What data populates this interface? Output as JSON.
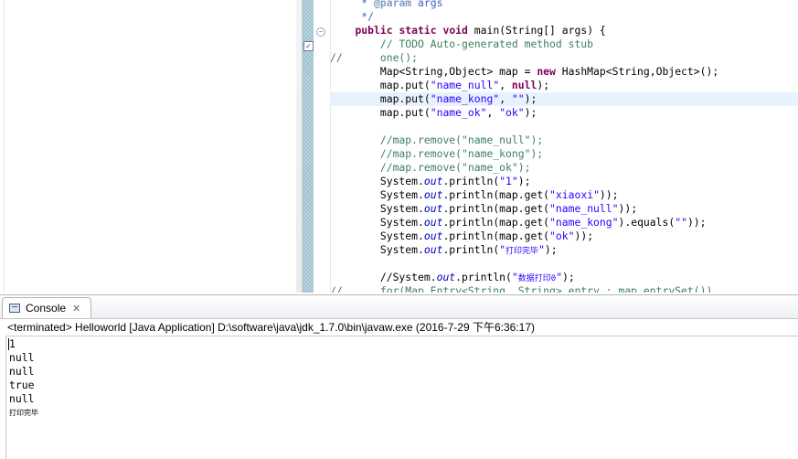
{
  "editor": {
    "lines": [
      "     * @param args",
      "     */",
      "    public static void main(String[] args) {",
      "        // TODO Auto-generated method stub",
      "//      one();",
      "        Map<String,Object> map = new HashMap<String,Object>();",
      "        map.put(\"name_null\", null);",
      "        map.put(\"name_kong\", \"\");",
      "        map.put(\"name_ok\", \"ok\");",
      "",
      "        //map.remove(\"name_null\");",
      "        //map.remove(\"name_kong\");",
      "        //map.remove(\"name_ok\");",
      "        System.out.println(\"1\");",
      "        System.out.println(map.get(\"xiaoxi\"));",
      "        System.out.println(map.get(\"name_null\"));",
      "        System.out.println(map.get(\"name_kong\").equals(\"\"));",
      "        System.out.println(map.get(\"ok\"));",
      "        System.out.println(\"打印完毕\");",
      "",
      "        //System.out.println(\"数据打印0\");",
      "//      for(Map.Entry<String, String> entry : map.entrySet())"
    ]
  },
  "console": {
    "tab_label": "Console",
    "close_glyph": "✕",
    "status": "<terminated> Helloworld [Java Application] D:\\software\\java\\jdk_1.7.0\\bin\\javaw.exe (2016-7-29 下午6:36:17)",
    "output": [
      "1",
      "null",
      "null",
      "true",
      "null",
      "打印完毕"
    ]
  },
  "icons": {
    "console": "console-icon",
    "close": "close-icon",
    "fold": "fold-minus-icon",
    "task": "task-marker-icon"
  },
  "colors": {
    "keyword": "#7f0055",
    "string": "#2a00ff",
    "comment": "#3f7f5f",
    "javadoc": "#3f5fbf",
    "static_field": "#0000c0",
    "current_line": "#e8f2fe"
  }
}
